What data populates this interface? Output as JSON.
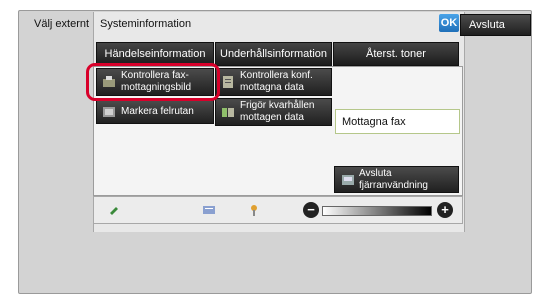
{
  "left_panel": {
    "label": "Välj externt"
  },
  "header": {
    "title": "Systeminformation",
    "ok_label": "OK",
    "exit_label": "Avsluta"
  },
  "tabs": [
    {
      "label": "Händelseinformation"
    },
    {
      "label": "Underhållsinformation"
    },
    {
      "label": "Återst. toner"
    }
  ],
  "buttons": {
    "check_fax_image": "Kontrollera fax-mottagningsbild",
    "check_received_conf": "Kontrollera konf. mottagna data",
    "mark_error": "Markera felrutan",
    "release_held": "Frigör kvarhållen mottagen data",
    "end_remote": "Avsluta fjärranvändning"
  },
  "fax_field": {
    "value": "Mottagna fax"
  },
  "bottom_bar": {
    "icons": [
      "wrench-icon",
      "keyboard-icon",
      "pin-icon"
    ],
    "minus": "−",
    "plus": "+"
  },
  "colors": {
    "highlight": "#d8002a",
    "ok": "#1f6fb8"
  }
}
